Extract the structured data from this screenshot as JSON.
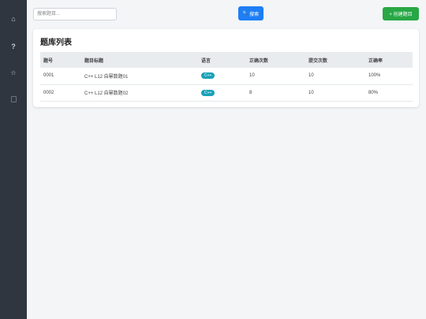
{
  "sidebar": {
    "items": [
      {
        "icon": "home-icon",
        "glyph": "⌂"
      },
      {
        "icon": "help-icon",
        "glyph": "?"
      },
      {
        "icon": "star-icon",
        "glyph": "☆"
      },
      {
        "icon": "square-icon",
        "glyph": ""
      }
    ]
  },
  "toolbar": {
    "search_placeholder": "搜索题目...",
    "search_label": "搜索",
    "search_icon_glyph": "🔍",
    "create_label": "+ 创建题目"
  },
  "card": {
    "title": "题库列表"
  },
  "table": {
    "headers": [
      "题号",
      "题目标题",
      "语言",
      "正确次数",
      "提交次数",
      "正确率"
    ],
    "rows": [
      {
        "id": "0001",
        "title": "C++ L12 自幂数题01",
        "language": "C++",
        "correct": "10",
        "submitted": "10",
        "rate": "100%"
      },
      {
        "id": "0002",
        "title": "C++ L12 自幂数题02",
        "language": "C++",
        "correct": "8",
        "submitted": "10",
        "rate": "80%"
      }
    ]
  },
  "colors": {
    "sidebar_bg": "#2f3640",
    "primary": "#1e7ef5",
    "success": "#28a745",
    "badge": "#17a2b8"
  }
}
